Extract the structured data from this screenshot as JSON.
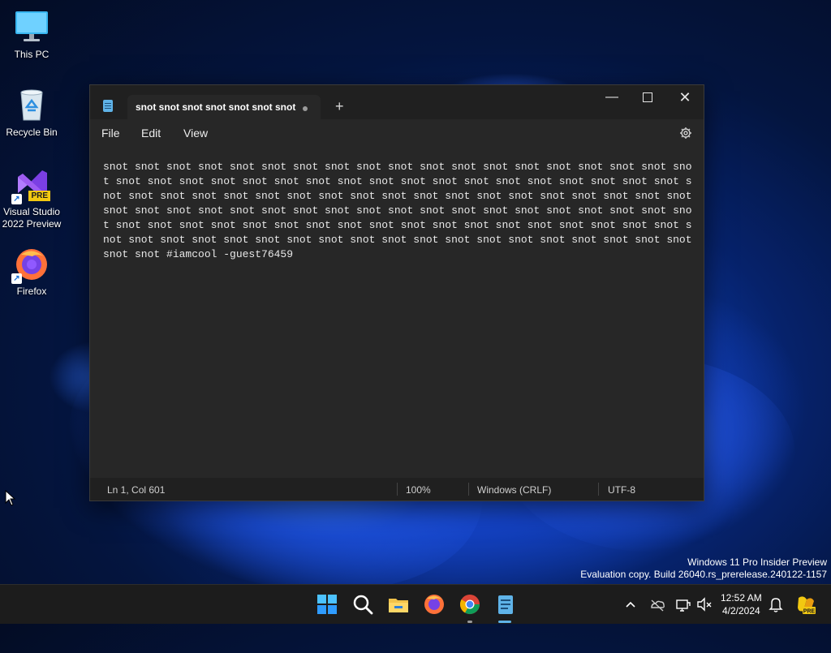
{
  "desktop": {
    "icons": [
      {
        "label": "This PC",
        "icon": "monitor-icon"
      },
      {
        "label": "Recycle Bin",
        "icon": "recycle-bin-icon"
      },
      {
        "label": "Visual Studio 2022 Preview",
        "icon": "visual-studio-icon",
        "badge": "PRE"
      },
      {
        "label": "Firefox",
        "icon": "firefox-icon"
      }
    ]
  },
  "notepad": {
    "tab_title": "snot snot snot snot snot snot snot",
    "menu": [
      "File",
      "Edit",
      "View"
    ],
    "content": "snot snot snot snot snot snot snot snot snot snot snot snot snot snot snot snot snot snot snot snot snot snot snot snot snot snot snot snot snot snot snot snot snot snot snot snot snot snot snot snot snot snot snot snot snot snot snot snot snot snot snot snot snot snot snot snot snot snot snot snot snot snot snot snot snot snot snot snot snot snot snot snot snot snot snot snot snot snot snot snot snot snot snot snot snot snot snot snot snot snot snot snot snot snot snot snot snot snot snot snot snot snot snot snot snot snot snot snot snot snot snot snot snot snot #iamcool -guest76459",
    "status": {
      "position": "Ln 1, Col 601",
      "zoom": "100%",
      "line_ending": "Windows (CRLF)",
      "encoding": "UTF-8"
    }
  },
  "watermark": {
    "line1": "Windows 11 Pro Insider Preview",
    "line2": "Evaluation copy. Build 26040.rs_prerelease.240122-1157"
  },
  "taskbar": {
    "apps": [
      "start-icon",
      "search-icon",
      "file-explorer-icon",
      "firefox-icon",
      "chrome-icon",
      "notepad-icon"
    ],
    "time": "12:52 AM",
    "date": "4/2/2024"
  },
  "colors": {
    "accent": "#5fb3e8",
    "window_bg": "#272727",
    "titlebar_bg": "#202020",
    "taskbar_bg": "#1c1c1c"
  }
}
